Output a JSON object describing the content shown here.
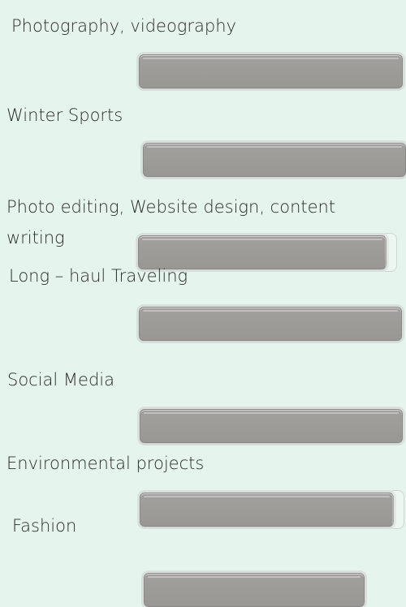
{
  "items": [
    {
      "label": "Photography, videography"
    },
    {
      "label": "Winter Sports"
    },
    {
      "label": "Photo editing, Website design, content writing"
    },
    {
      "label": "Long – haul Traveling"
    },
    {
      "label": "Social Media"
    },
    {
      "label": "Environmental projects"
    },
    {
      "label": "Fashion"
    }
  ]
}
